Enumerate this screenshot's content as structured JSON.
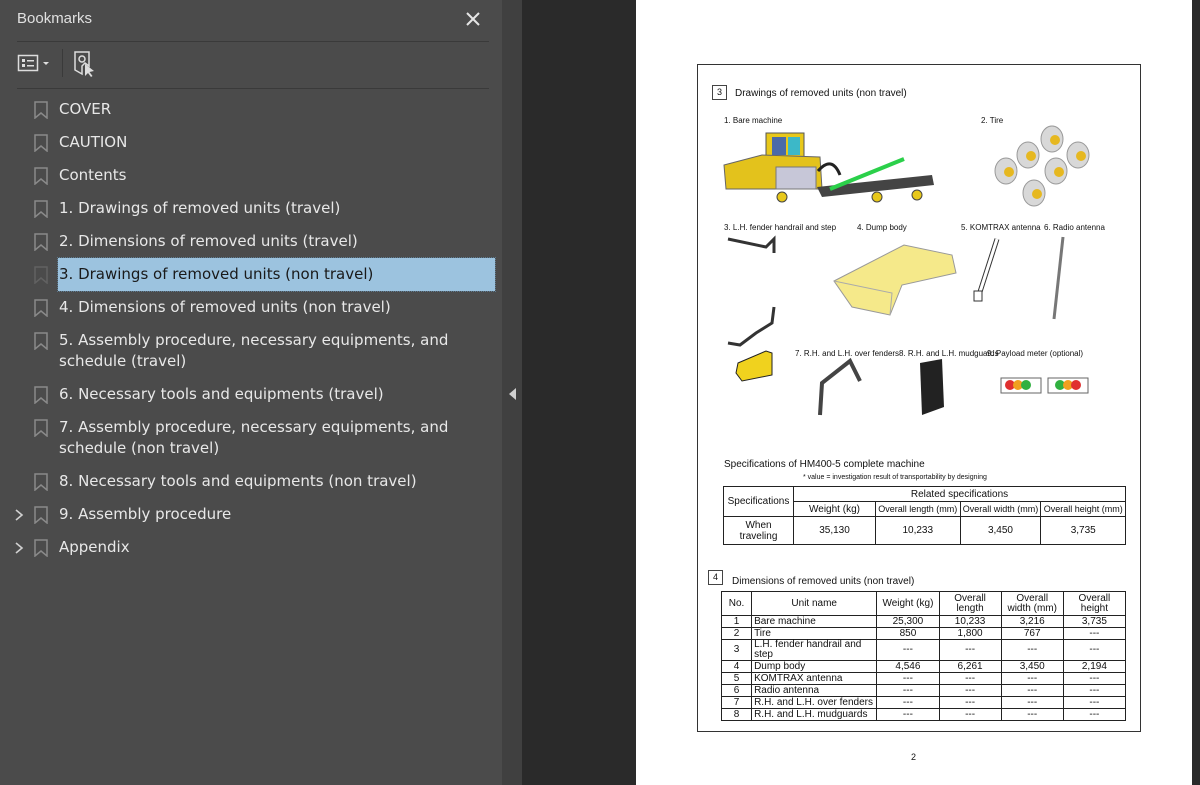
{
  "panel": {
    "title": "Bookmarks",
    "icons": {
      "close": "close-icon",
      "options": "options-menu-icon",
      "find": "find-current-bookmark-icon"
    },
    "items": [
      {
        "label": "COVER",
        "expandable": false,
        "selected": false
      },
      {
        "label": "CAUTION",
        "expandable": false,
        "selected": false
      },
      {
        "label": "Contents",
        "expandable": false,
        "selected": false
      },
      {
        "label": "1. Drawings of removed units (travel)",
        "expandable": false,
        "selected": false
      },
      {
        "label": "2. Dimensions of removed units (travel)",
        "expandable": false,
        "selected": false
      },
      {
        "label": "3. Drawings of removed units (non travel)",
        "expandable": false,
        "selected": true
      },
      {
        "label": "4. Dimensions of removed units (non travel)",
        "expandable": false,
        "selected": false
      },
      {
        "label": "5. Assembly procedure, necessary equipments, and schedule (travel)",
        "expandable": false,
        "selected": false
      },
      {
        "label": "6. Necessary tools and equipments (travel)",
        "expandable": false,
        "selected": false
      },
      {
        "label": "7. Assembly procedure, necessary equipments, and schedule (non travel)",
        "expandable": false,
        "selected": false
      },
      {
        "label": "8. Necessary tools and equipments (non travel)",
        "expandable": false,
        "selected": false
      },
      {
        "label": "9. Assembly procedure",
        "expandable": true,
        "selected": false
      },
      {
        "label": "Appendix",
        "expandable": true,
        "selected": false
      }
    ]
  },
  "document": {
    "section3": {
      "number": "3",
      "title": "Drawings of removed units (non travel)",
      "captions": {
        "c1": "1. Bare machine",
        "c2": "2. Tire",
        "c3": "3. L.H. fender handrail and step",
        "c4": "4. Dump body",
        "c5": "5. KOMTRAX antenna",
        "c6": "6. Radio antenna",
        "c7": "7. R.H. and L.H. over fenders",
        "c8": "8. R.H. and L.H. mudguards",
        "c9": "9. Payload meter (optional)"
      }
    },
    "specs": {
      "title": "Specifications of HM400-5 complete machine",
      "note": "* value = investigation result of transportability by designing",
      "header_left": "Specifications",
      "header_group": "Related specifications",
      "columns": [
        "Weight (kg)",
        "Overall length (mm)",
        "Overall width (mm)",
        "Overall height (mm)"
      ],
      "row": {
        "label": "When traveling",
        "values": [
          "35,130",
          "10,233",
          "3,450",
          "3,735"
        ]
      }
    },
    "section4": {
      "number": "4",
      "title": "Dimensions of removed units (non travel)",
      "columns": [
        "No.",
        "Unit name",
        "Weight (kg)",
        "Overall length",
        "Overall width (mm)",
        "Overall height"
      ],
      "rows": [
        [
          "1",
          "Bare machine",
          "25,300",
          "10,233",
          "3,216",
          "3,735"
        ],
        [
          "2",
          "Tire",
          "850",
          "1,800",
          "767",
          "---"
        ],
        [
          "3",
          "L.H. fender handrail and step",
          "---",
          "---",
          "---",
          "---"
        ],
        [
          "4",
          "Dump body",
          "4,546",
          "6,261",
          "3,450",
          "2,194"
        ],
        [
          "5",
          "KOMTRAX antenna",
          "---",
          "---",
          "---",
          "---"
        ],
        [
          "6",
          "Radio antenna",
          "---",
          "---",
          "---",
          "---"
        ],
        [
          "7",
          "R.H. and L.H. over fenders",
          "---",
          "---",
          "---",
          "---"
        ],
        [
          "8",
          "R.H. and L.H. mudguards",
          "---",
          "---",
          "---",
          "---"
        ]
      ]
    },
    "page_number": "2"
  },
  "colors": {
    "selection": "#9cc3df",
    "panel_bg": "#4b4b4b",
    "viewer_bg": "#2a2a2a",
    "machine_yellow": "#e8c81a"
  }
}
